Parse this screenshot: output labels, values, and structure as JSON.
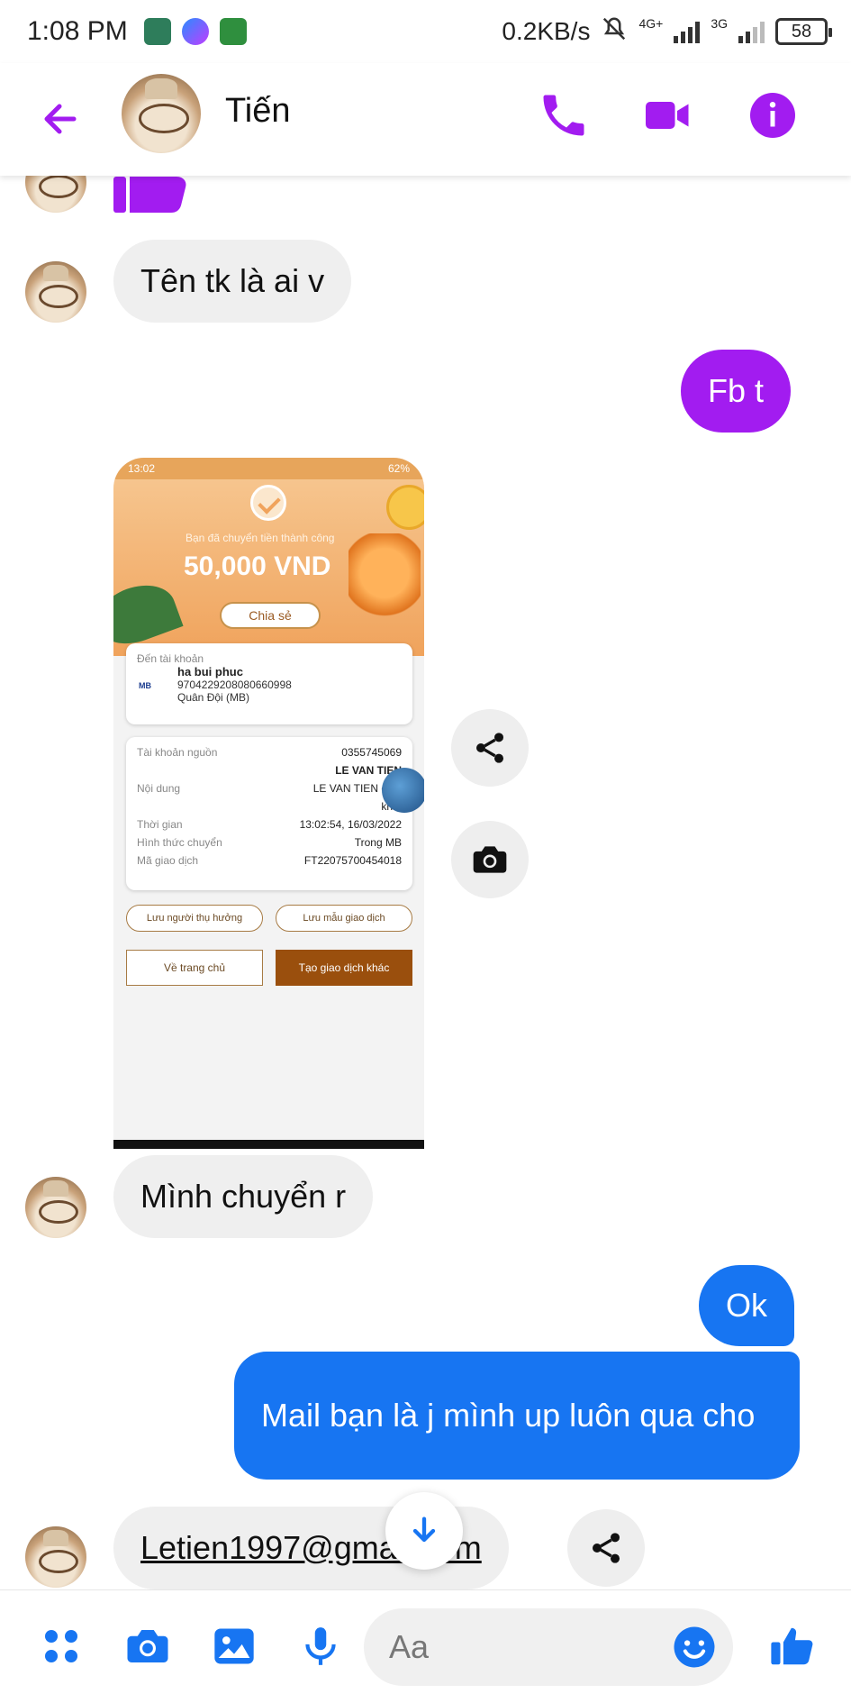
{
  "status_bar": {
    "time": "1:08 PM",
    "net_speed": "0.2KB/s",
    "signal1_label": "4G+",
    "signal2_label": "3G",
    "battery": "58"
  },
  "header": {
    "contact_name": "Tiến",
    "accent_color": "#a21cf0"
  },
  "messages": {
    "m1": "Tên tk là ai v",
    "m2": "Fb t",
    "m3": "Mình chuyển r",
    "m4": "Ok",
    "m5": "Mail bạn là j mình up luôn qua cho",
    "m6": "Letien1997@gmail.com"
  },
  "screenshot": {
    "status_time": "13:02",
    "status_right": "62%",
    "subtitle": "Bạn đã chuyển tiền thành công",
    "amount": "50,000 VND",
    "share_label": "Chia sẻ",
    "to_account_label": "Đến tài khoản",
    "recipient_name": "ha bui phuc",
    "recipient_account": "9704229208080660998",
    "bank": "Quân Đội (MB)",
    "bank_logo": "MB",
    "rows": [
      {
        "k": "Tài khoản nguồn",
        "v": "0355745069"
      },
      {
        "k": "",
        "v": "LE VAN TIEN"
      },
      {
        "k": "Nội dung",
        "v": "LE VAN TIEN ch..."
      },
      {
        "k": "",
        "v": "kh..."
      },
      {
        "k": "Thời gian",
        "v": "13:02:54, 16/03/2022"
      },
      {
        "k": "Hình thức chuyển",
        "v": "Trong MB"
      },
      {
        "k": "Mã giao dịch",
        "v": "FT22075700454018"
      }
    ],
    "save_beneficiary": "Lưu người thụ hưởng",
    "save_template": "Lưu mẫu giao dịch",
    "home_button": "Về trang chủ",
    "new_transaction": "Tạo giao dịch khác"
  },
  "composer": {
    "placeholder": "Aa",
    "accent_color": "#1775f2"
  }
}
